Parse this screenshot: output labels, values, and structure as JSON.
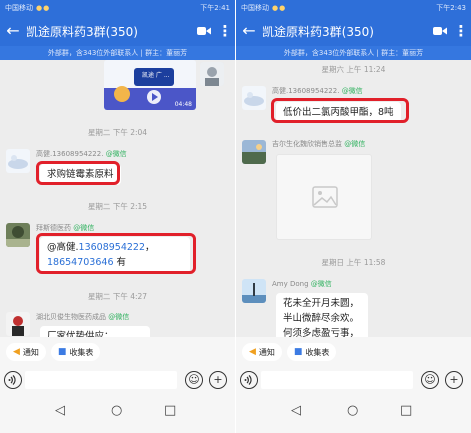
{
  "colors": {
    "brand": "#2e6fd9",
    "highlight": "#e1202a",
    "wechat_tag": "#2fb15e",
    "link": "#2a6fd6"
  },
  "left": {
    "status": {
      "carrier": "中国移动",
      "right": "下午2:41"
    },
    "header": {
      "back": "←",
      "title": "凯途原料药3群(350)",
      "more": "⋮"
    },
    "subbar": "外部群，含343位外部联系人 | 群主：董丽芳",
    "video": {
      "label": "凯途 广 ...",
      "duration": "04:48"
    },
    "ts1": "星期二 下午 2:04",
    "msg1": {
      "sender": "高健.13608954222.",
      "tag": "@微信",
      "text": "求购链霉素原料"
    },
    "ts2": "星期二 下午 2:15",
    "msg2": {
      "sender": "拜斯德医药",
      "tag": "@微信",
      "mention": "@高健.",
      "phone1": "13608954222",
      "comma": "，",
      "phone2": "18654703646",
      "suffix": " 有"
    },
    "ts3": "星期二 下午 4:27",
    "msg3": {
      "sender": "湖北贝俊生物医药成品",
      "tag": "@微信",
      "text": "厂家优势供应："
    }
  },
  "right": {
    "status": {
      "carrier": "中国移动",
      "right": "下午2:43"
    },
    "header": {
      "back": "←",
      "title": "凯途原料药3群(350)",
      "more": "⋮"
    },
    "subbar": "外部群，含343位外部联系人 | 群主：董丽芳",
    "ts1": "星期六 上午 11:24",
    "msg1": {
      "sender": "高健.13608954222.",
      "tag": "@微信",
      "text": "低价出二氯丙酸甲酯，8吨"
    },
    "msg2": {
      "sender": "吉尔生化魏欣销售总监",
      "tag": "@微信"
    },
    "ts2": "星期日 上午 11:58",
    "msg3": {
      "sender": "Amy Dong",
      "tag": "@微信",
      "lines": [
        "花未全开月未圆，",
        "半山微醉尽余欢。",
        "何须多虑盈亏事，"
      ]
    }
  },
  "bottom": {
    "notice": "通知",
    "form": "收集表",
    "voice_icon": "voice-icon",
    "emoji": "☺",
    "plus": "+"
  },
  "nav": {
    "back": "◁",
    "home": "○",
    "recent": "□"
  }
}
